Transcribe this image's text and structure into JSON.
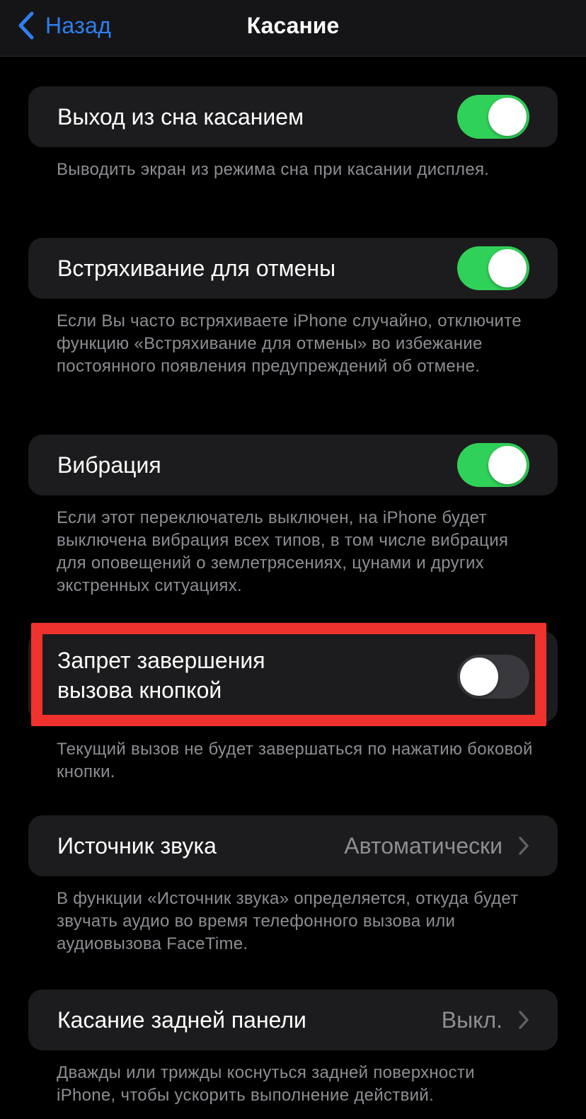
{
  "nav": {
    "back_label": "Назад",
    "title": "Касание"
  },
  "settings": [
    {
      "label": "Выход из сна касанием",
      "toggle_on": true,
      "footer": "Выводить экран из режима сна при касании дисплея."
    },
    {
      "label": "Встряхивание для отмены",
      "toggle_on": true,
      "footer": "Если Вы часто встряхиваете iPhone случайно, отключите функцию «Встряхивание для отмены» во избежание постоянного появления предупреждений об отмене."
    },
    {
      "label": "Вибрация",
      "toggle_on": true,
      "footer": "Если этот переключатель выключен, на iPhone будет выключена вибрация всех типов, в том числе вибрация для оповещений о землетрясениях, цунами и других экстренных ситуациях."
    },
    {
      "label_line1": "Запрет завершения",
      "label_line2": "вызова кнопкой",
      "toggle_on": false,
      "footer": "Текущий вызов не будет завершаться по нажатию боковой кнопки."
    },
    {
      "label": "Источник звука",
      "value": "Автоматически",
      "footer": "В функции «Источник звука» определяется, откуда будет звучать аудио во время телефонного вызова или аудиовызова FaceTime."
    },
    {
      "label": "Касание задней панели",
      "value": "Выкл.",
      "footer": "Дважды или трижды коснуться задней поверхности iPhone, чтобы ускорить выполнение действий."
    }
  ],
  "colors": {
    "background": "#000000",
    "cell": "#1c1c1e",
    "toggle_on": "#30d158",
    "toggle_off": "#39393d",
    "accent": "#2f7ff0",
    "secondary_text": "#8d8d93",
    "highlight": "#f0322e"
  },
  "icons": [
    "chevron-left-icon",
    "chevron-right-icon"
  ]
}
